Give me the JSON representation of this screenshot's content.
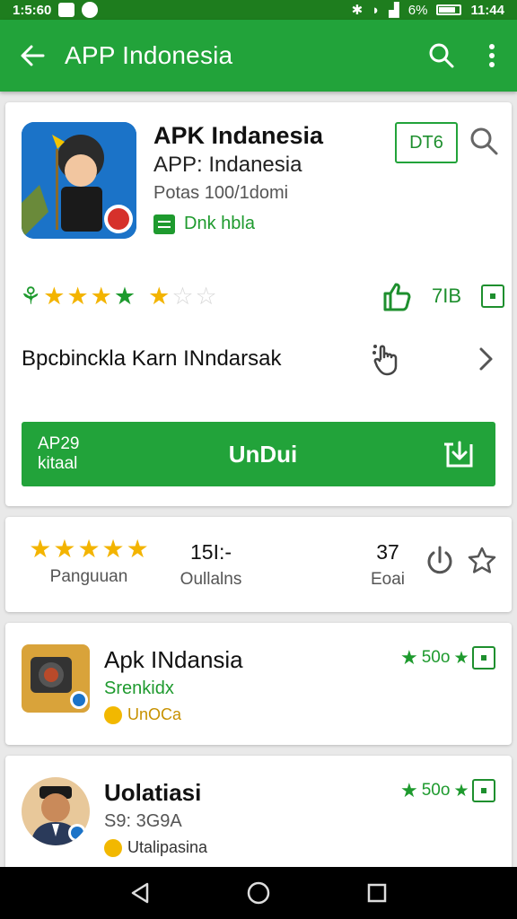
{
  "status_bar": {
    "time_left": "1:5:60",
    "battery": "6%",
    "time_right": "11:44"
  },
  "app_bar": {
    "title": "APP Indonesia"
  },
  "app": {
    "title": "APK Indanesia",
    "subtitle": "APP: Indanesia",
    "meta": "Potas 100/1domi",
    "badge_text": "Dnk hbla",
    "outline_button": "DT6"
  },
  "rating": {
    "count": "7IB"
  },
  "description": {
    "text": "Bpcbinckla Karn INndarsak"
  },
  "install_button": {
    "left_line1": "AP29",
    "left_line2": "kitaal",
    "label": "UnDui"
  },
  "stats": {
    "rating_label": "Panguuan",
    "downloads_value": "15I:-",
    "downloads_label": "Oullalns",
    "size_value": "37",
    "size_label": "Eoai"
  },
  "list": [
    {
      "name": "Apk INdansia",
      "sub": "Srenkidx",
      "tag": "UnOCa",
      "rate": "50o"
    },
    {
      "name": "Uolatiasi",
      "sub": "S9: 3G9A",
      "tag": "Utalipasina",
      "rate": "50o"
    }
  ],
  "colors": {
    "primary": "#22a33a",
    "status_bar": "#1e7d1e",
    "star": "#f3b400"
  },
  "icons": [
    "back-arrow-icon",
    "search-icon",
    "overflow-menu-icon",
    "download-icon",
    "star-outline-icon",
    "hand-pointer-icon",
    "chevron-right-icon"
  ]
}
